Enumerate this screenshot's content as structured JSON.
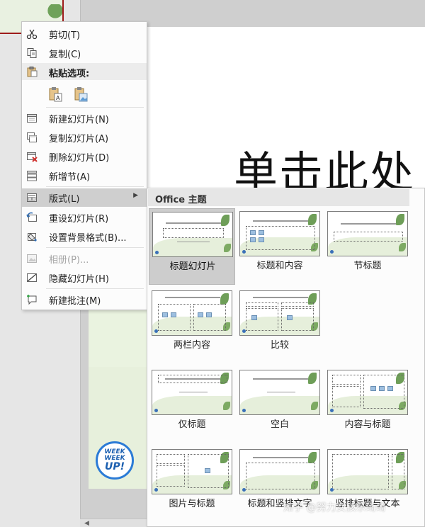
{
  "editor": {
    "slide_title": "单击此处",
    "logo": {
      "line1": "WEEK",
      "line2": "WEEK",
      "line3": "UP!"
    }
  },
  "context_menu": {
    "items": [
      {
        "label": "剪切(T)",
        "icon": "scissors-icon"
      },
      {
        "label": "复制(C)",
        "icon": "copy-icon"
      },
      {
        "label": "粘贴选项:",
        "icon": "clipboard-icon"
      },
      {
        "label": "新建幻灯片(N)",
        "icon": "new-slide-icon"
      },
      {
        "label": "复制幻灯片(A)",
        "icon": "duplicate-slide-icon"
      },
      {
        "label": "删除幻灯片(D)",
        "icon": "delete-slide-icon"
      },
      {
        "label": "新增节(A)",
        "icon": "add-section-icon"
      },
      {
        "label": "版式(L)",
        "icon": "layout-icon"
      },
      {
        "label": "重设幻灯片(R)",
        "icon": "reset-slide-icon"
      },
      {
        "label": "设置背景格式(B)...",
        "icon": "format-background-icon"
      },
      {
        "label": "相册(P)...",
        "icon": "photo-album-icon",
        "disabled": true
      },
      {
        "label": "隐藏幻灯片(H)",
        "icon": "hide-slide-icon"
      },
      {
        "label": "新建批注(M)",
        "icon": "new-comment-icon"
      }
    ],
    "paste_options": [
      "keep-text-only-icon",
      "paste-as-picture-icon"
    ]
  },
  "layout_gallery": {
    "header": "Office 主题",
    "selected": "标题幻灯片",
    "layouts": [
      "标题幻灯片",
      "标题和内容",
      "节标题",
      "两栏内容",
      "比较",
      "仅标题",
      "空白",
      "内容与标题",
      "图片与标题",
      "标题和竖排文字",
      "竖排标题与文本"
    ]
  },
  "watermark": "知乎 @努力女孩乐琦琦",
  "colors": {
    "menu_hover": "#cfcfcf",
    "selected_layout": "#cdcdcd",
    "theme_green": "#e6efdb",
    "accent_leaf": "#6e9e58"
  }
}
